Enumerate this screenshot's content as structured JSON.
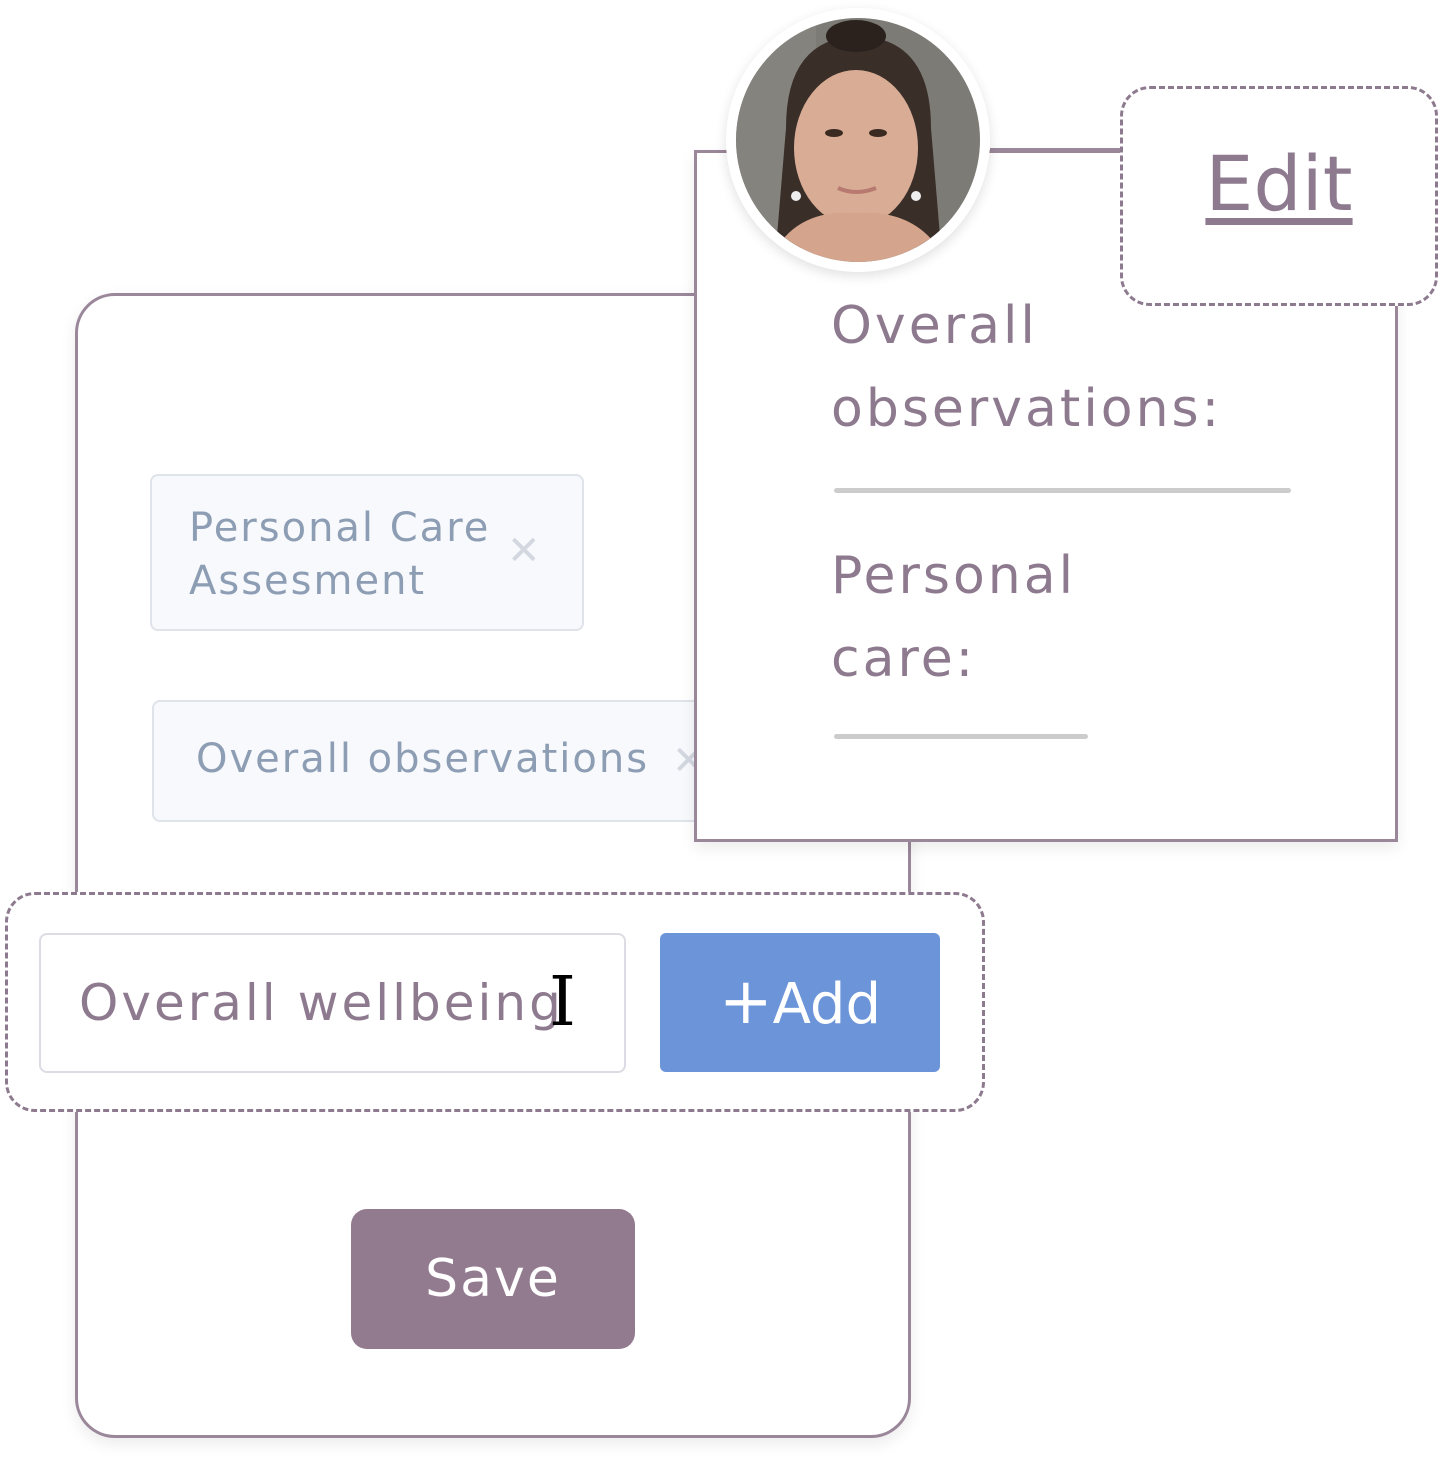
{
  "form": {
    "tags": [
      {
        "label": "Personal Care Assesment",
        "remove_icon": "close-icon"
      },
      {
        "label": "Overall observations",
        "remove_icon": "close-icon"
      }
    ],
    "input_value": "Overall wellbeing",
    "add_label": "Add",
    "add_icon": "plus-icon",
    "save_label": "Save"
  },
  "profile": {
    "edit_label": "Edit",
    "fields": [
      {
        "label_line1": "Overall",
        "label_line2": "observations:"
      },
      {
        "label_line1": "Personal",
        "label_line2": "care:"
      }
    ]
  },
  "colors": {
    "accent": "#8e7a8f",
    "add_button": "#6b94d9",
    "save_button": "#927b8f",
    "tag_text": "#8d9db3"
  }
}
